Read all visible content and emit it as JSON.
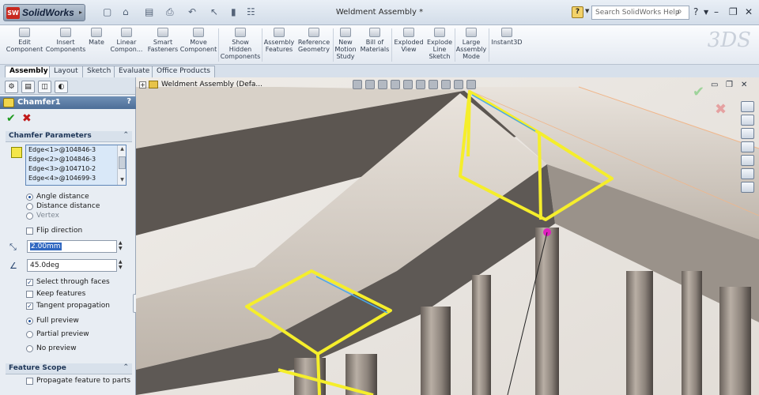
{
  "app": {
    "logo_text": "SolidWorks",
    "logo_mark": "SW",
    "document_title": "Weldment Assembly *",
    "search_placeholder": "Search SolidWorks Help",
    "help_label": "?"
  },
  "ribbon": {
    "buttons": [
      {
        "label": "Edit\nComponent",
        "icon": "edit-component-icon"
      },
      {
        "label": "Insert\nComponents",
        "icon": "insert-components-icon"
      },
      {
        "label": "Mate",
        "icon": "mate-icon"
      },
      {
        "label": "Linear\nCompon...",
        "icon": "linear-pattern-icon"
      },
      {
        "label": "Smart\nFasteners",
        "icon": "smart-fasteners-icon"
      },
      {
        "label": "Move\nComponent",
        "icon": "move-component-icon"
      },
      {
        "label": "Show\nHidden\nComponents",
        "icon": "show-hidden-icon"
      },
      {
        "label": "Assembly\nFeatures",
        "icon": "assembly-features-icon"
      },
      {
        "label": "Reference\nGeometry",
        "icon": "reference-geometry-icon"
      },
      {
        "label": "New\nMotion\nStudy",
        "icon": "motion-study-icon"
      },
      {
        "label": "Bill of\nMaterials",
        "icon": "bom-icon"
      },
      {
        "label": "Exploded\nView",
        "icon": "exploded-view-icon"
      },
      {
        "label": "Explode\nLine\nSketch",
        "icon": "explode-line-icon"
      },
      {
        "label": "Large\nAssembly\nMode",
        "icon": "large-assembly-icon"
      },
      {
        "label": "Instant3D",
        "icon": "instant3d-icon"
      }
    ]
  },
  "tabs": [
    "Assembly",
    "Layout",
    "Sketch",
    "Evaluate",
    "Office Products"
  ],
  "property_manager": {
    "title": "Chamfer1",
    "help": "?",
    "ok_symbol": "✔",
    "cancel_symbol": "✖",
    "chamfer_parameters": {
      "header": "Chamfer Parameters",
      "edges": [
        "Edge<1>@104846-3",
        "Edge<2>@104846-3",
        "Edge<3>@104710-2",
        "Edge<4>@104699-3"
      ],
      "type_options": [
        {
          "label": "Angle distance",
          "selected": true,
          "enabled": true
        },
        {
          "label": "Distance distance",
          "selected": false,
          "enabled": true
        },
        {
          "label": "Vertex",
          "selected": false,
          "enabled": false
        }
      ],
      "flip_direction": {
        "label": "Flip direction",
        "checked": false
      },
      "distance_value": "2.00mm",
      "angle_value": "45.0deg",
      "checkboxes": [
        {
          "label": "Select through faces",
          "checked": true
        },
        {
          "label": "Keep features",
          "checked": false
        },
        {
          "label": "Tangent propagation",
          "checked": true
        }
      ],
      "preview_options": [
        {
          "label": "Full preview",
          "selected": true
        },
        {
          "label": "Partial preview",
          "selected": false
        },
        {
          "label": "No preview",
          "selected": false
        }
      ]
    },
    "feature_scope": {
      "header": "Feature Scope",
      "propagate": {
        "label": "Propagate feature to parts",
        "checked": false
      }
    }
  },
  "viewport": {
    "tree_label": "Weldment Assembly  (Defa..."
  },
  "colors": {
    "selection_highlight": "#f5ee2b",
    "header_blue": "#4d6e98",
    "beam_face": "#d9d2c9",
    "beam_dark": "#5e5955"
  }
}
